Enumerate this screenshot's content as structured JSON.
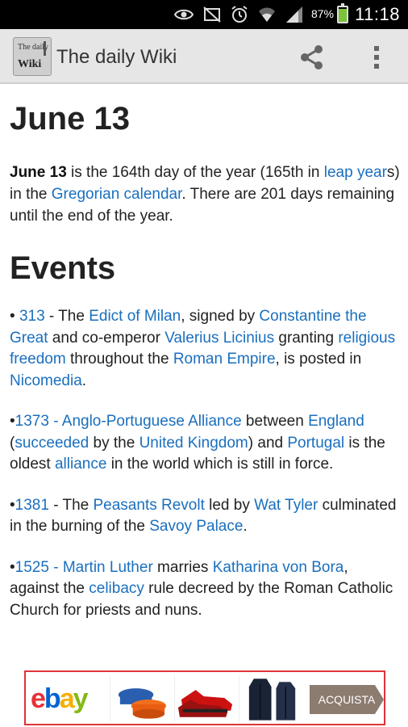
{
  "status_bar": {
    "battery_percent_text": "87%",
    "battery_level": 0.87,
    "time": "11:18"
  },
  "action_bar": {
    "logo_text_top": "The daily",
    "logo_text_bottom": "Wiki",
    "title": "The daily Wiki"
  },
  "content": {
    "page_title": "June 13",
    "intro": {
      "date": "June 13",
      "t1": " is the 164th day of the year (165th in ",
      "link_leap": "leap year",
      "t2": "s) in the ",
      "link_gregorian": "Gregorian calendar",
      "t3": ". There are 201 days remaining until the end of the year."
    },
    "events_heading": "Events",
    "events": [
      {
        "bullet": "• ",
        "year": "313",
        "sep": " - The ",
        "l_edict": "Edict of Milan",
        "t_a": ", signed by ",
        "l_constantine": "Constantine the Great",
        "t_b": " and co-emperor ",
        "l_licinius": "Valerius Licinius",
        "t_c": " granting ",
        "l_freedom": "religious freedom",
        "t_d": " throughout the ",
        "l_empire": "Roman Empire",
        "t_e": ", is posted in ",
        "l_nicomedia": "Nicomedia",
        "t_f": "."
      },
      {
        "bullet": "•",
        "year": "1373",
        "sep": " - ",
        "l_alliance_title": "Anglo-Portuguese Alliance",
        "t_a": " between ",
        "l_england": "England",
        "t_b": " (",
        "l_succeeded": "succeeded",
        "t_c": " by the ",
        "l_uk": "United Kingdom",
        "t_d": ") and ",
        "l_portugal": "Portugal",
        "t_e": " is the oldest ",
        "l_alliance": "alliance",
        "t_f": " in the world which is still in force."
      },
      {
        "bullet": "•",
        "year": "1381",
        "sep": " - The ",
        "l_revolt": "Peasants Revolt",
        "t_a": " led by ",
        "l_tyler": "Wat Tyler",
        "t_b": " culminated in the burning of the ",
        "l_savoy": "Savoy Palace",
        "t_c": "."
      },
      {
        "bullet": "•",
        "year": "1525",
        "sep": " - ",
        "l_luther": "Martin Luther",
        "t_a": " marries ",
        "l_katharina": "Katharina von Bora",
        "t_b": ", against the ",
        "l_celibacy": "celibacy",
        "t_c": " rule decreed by the Roman Catholic Church for priests and nuns."
      }
    ]
  },
  "ad": {
    "brand_e": "e",
    "brand_b": "b",
    "brand_a": "a",
    "brand_y": "y",
    "cta": "ACQUISTA"
  },
  "colors": {
    "link": "#1a6fbe",
    "action_bar": "#e6e6e6",
    "ad_border": "#e0333a"
  }
}
